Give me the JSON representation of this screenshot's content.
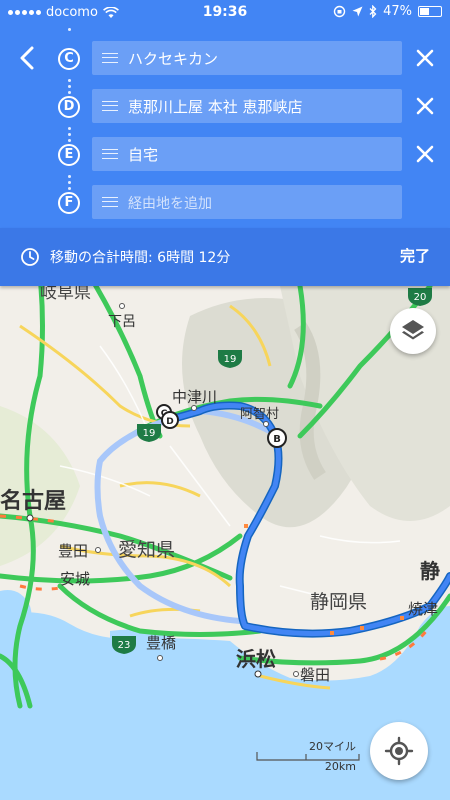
{
  "status_bar": {
    "carrier": "docomo",
    "time": "19:36",
    "battery": "47%",
    "battery_level": 0.47
  },
  "header": {
    "stops": [
      {
        "letter": "C",
        "name": "ハクセキカン"
      },
      {
        "letter": "D",
        "name": "恵那川上屋 本社 恵那峡店"
      },
      {
        "letter": "E",
        "name": "自宅"
      },
      {
        "letter": "F",
        "placeholder": "経由地を追加"
      }
    ]
  },
  "summary": {
    "total_time": "移動の合計時間: 6時間 12分",
    "done_label": "完了"
  },
  "map": {
    "labels": {
      "gifu": "岐阜県",
      "gero": "下呂",
      "nakatsugawa": "中津川",
      "achimura": "阿智村",
      "nagoya": "名古屋",
      "toyota": "豊田",
      "aichi": "愛知県",
      "anjo": "安城",
      "toyohashi": "豊橋",
      "hamamatsu": "浜松",
      "iwata": "磐田",
      "shizuoka_pref": "静岡県",
      "yaizu": "焼津",
      "shizuoka_city": "静"
    },
    "road_shields": [
      "20",
      "19",
      "19",
      "23"
    ],
    "markers": {
      "b": "B",
      "c": "C",
      "d": "D"
    },
    "scale": {
      "miles": "20マイル",
      "km": "20km"
    }
  },
  "colors": {
    "header_blue": "#4285f4",
    "route_blue": "#4285f4",
    "route_alt": "#a8c7fa",
    "highway_green": "#3ec95a",
    "road_yellow": "#f7d55b",
    "water": "#aadaff",
    "land": "#f2efe9"
  },
  "icons": [
    "back-arrow-icon",
    "drag-handle-icon",
    "close-icon",
    "clock-icon",
    "layers-icon",
    "my-location-icon"
  ]
}
